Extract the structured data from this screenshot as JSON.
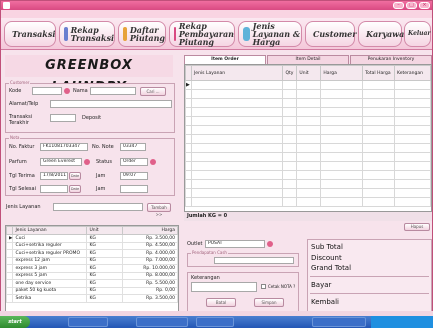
{
  "window": {
    "title": ""
  },
  "menu": [],
  "toolbar": {
    "items": [
      {
        "label": "Transaksi",
        "color": "#3aa66a"
      },
      {
        "label": "Rekap Transaksi",
        "color": "#6a7fd0"
      },
      {
        "label": "Daftar Piutang",
        "color": "#e7a33a"
      },
      {
        "label": "Rekap Pembayaran Piutang",
        "color": "#d94a82"
      },
      {
        "label": "Jenis Layanan & Harga",
        "color": "#5fb3d9"
      },
      {
        "label": "Customer",
        "color": "#e25c5c"
      },
      {
        "label": "Karyawan",
        "color": "#b06ad0"
      },
      {
        "label": "Keluar",
        "color": "#3aa66a"
      }
    ]
  },
  "logo": {
    "text": "GREENBOX LAUNDRY"
  },
  "customer": {
    "legend": "Customer",
    "kode_label": "Kode",
    "kode_value": "",
    "nama_label": "Nama",
    "nama_value": "",
    "cari_label": "Cari ...",
    "alamat_label": "Alamat/Telp",
    "transaksi_label": "Transaksi Terakhir",
    "deposit_label": "Deposit"
  },
  "nota": {
    "legend": "Nota",
    "faktur_label": "No. Faktur",
    "faktur_value": "FK11081703347",
    "nonote_label": "No. Note",
    "nonote_value": "03347",
    "parfum_label": "Parfum",
    "parfum_value": "Green Everest",
    "status_label": "Status",
    "status_value": "Order",
    "terima_label": "Tgl Terima",
    "terima_value": "17/8/2011",
    "jam_label": "Jam",
    "jam_terima": "09:07",
    "selesai_label": "Tgl Selesai",
    "jam_selesai": "",
    "date_btn": "Date"
  },
  "layanan": {
    "label": "Jenis Layanan",
    "value": "",
    "tambah": "Tambah >>",
    "columns": [
      "Jenis Layanan",
      "Unit",
      "Harga"
    ],
    "rows": [
      [
        "Cuci",
        "KG",
        "Rp. 3.500,00"
      ],
      [
        "Cuci+setrika reguler",
        "KG",
        "Rp. 4.500,00"
      ],
      [
        "Cuci+setrika reguler PROMO",
        "KG",
        "Rp. 4.000,00"
      ],
      [
        "express 12 jam",
        "KG",
        "Rp. 7.000,00"
      ],
      [
        "express 3 jam",
        "KG",
        "Rp. 10.000,00"
      ],
      [
        "express 5 jam",
        "KG",
        "Rp. 8.000,00"
      ],
      [
        "one day service",
        "KG",
        "Rp. 5.500,00"
      ],
      [
        "paket 50 kg kuota",
        "KG",
        "Rp. 0,00"
      ],
      [
        "Setrika",
        "KG",
        "Rp. 3.500,00"
      ]
    ]
  },
  "tabs": [
    "Item Order",
    "Item Detail",
    "Penukaran Inventory"
  ],
  "order_grid": {
    "columns": [
      "Jenis Layanan",
      "Qty",
      "Unit",
      "Harga",
      "Total Harga",
      "Keterangan"
    ]
  },
  "jumlah": "Jumlah KG = 0",
  "hapus": "Hapus",
  "outlet": {
    "label": "Outlet",
    "value": "PUSAT",
    "pendapatan_legend": "Pendapatan Cash",
    "row_label": "",
    "keterangan_label": "Keterangan",
    "keterangan_value": ""
  },
  "cetak": "Cetak NOTA ?",
  "batal": "Batal",
  "simpan": "Simpan",
  "totals": {
    "sub_total_label": "Sub Total",
    "sub_total": "",
    "discount_label": "Discount",
    "discount": "",
    "grand_total_label": "Grand Total",
    "grand_total": "",
    "bayar_label": "Bayar",
    "bayar": "",
    "kembali_label": "Kembali",
    "kembali": ""
  },
  "status_bar": "",
  "taskbar": {
    "start": "start",
    "tasks": [
      "",
      "",
      "",
      ""
    ],
    "clock": ""
  }
}
